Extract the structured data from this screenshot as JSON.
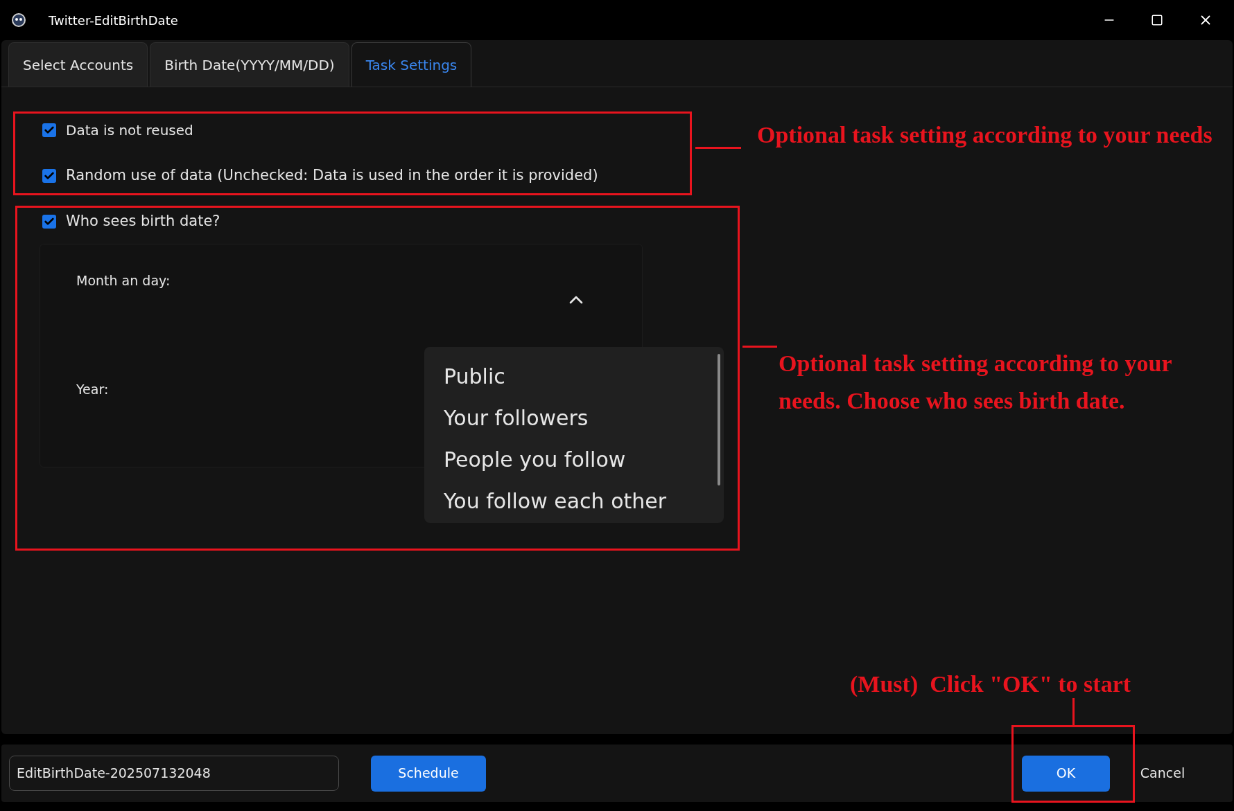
{
  "window": {
    "title": "Twitter-EditBirthDate"
  },
  "tabs": [
    {
      "label": "Select Accounts",
      "selected": false
    },
    {
      "label": "Birth Date(YYYY/MM/DD)",
      "selected": false
    },
    {
      "label": "Task Settings",
      "selected": true
    }
  ],
  "options": [
    {
      "label": "Data is not reused",
      "checked": true
    },
    {
      "label": "Random use of data (Unchecked: Data is used in the order it is provided)",
      "checked": true
    }
  ],
  "visibility": {
    "label": "Who sees birth date?",
    "checked": true,
    "fields": [
      {
        "label": "Month an day:"
      },
      {
        "label": "Year:"
      }
    ],
    "dropdown": {
      "expanded": true,
      "items": [
        {
          "label": "Public",
          "selected": false
        },
        {
          "label": "Your followers",
          "selected": false
        },
        {
          "label": "People you follow",
          "selected": false
        },
        {
          "label": "You follow each other",
          "selected": false
        }
      ]
    }
  },
  "footer": {
    "task_name": "EditBirthDate-202507132048",
    "schedule": "Schedule",
    "ok": "OK",
    "cancel": "Cancel"
  },
  "annotations": [
    {
      "text": "Optional task setting according to your needs"
    },
    {
      "text": "Optional task setting according to your needs. Choose who sees birth date."
    },
    {
      "text": "(Must)  Click \"OK\" to start"
    }
  ]
}
